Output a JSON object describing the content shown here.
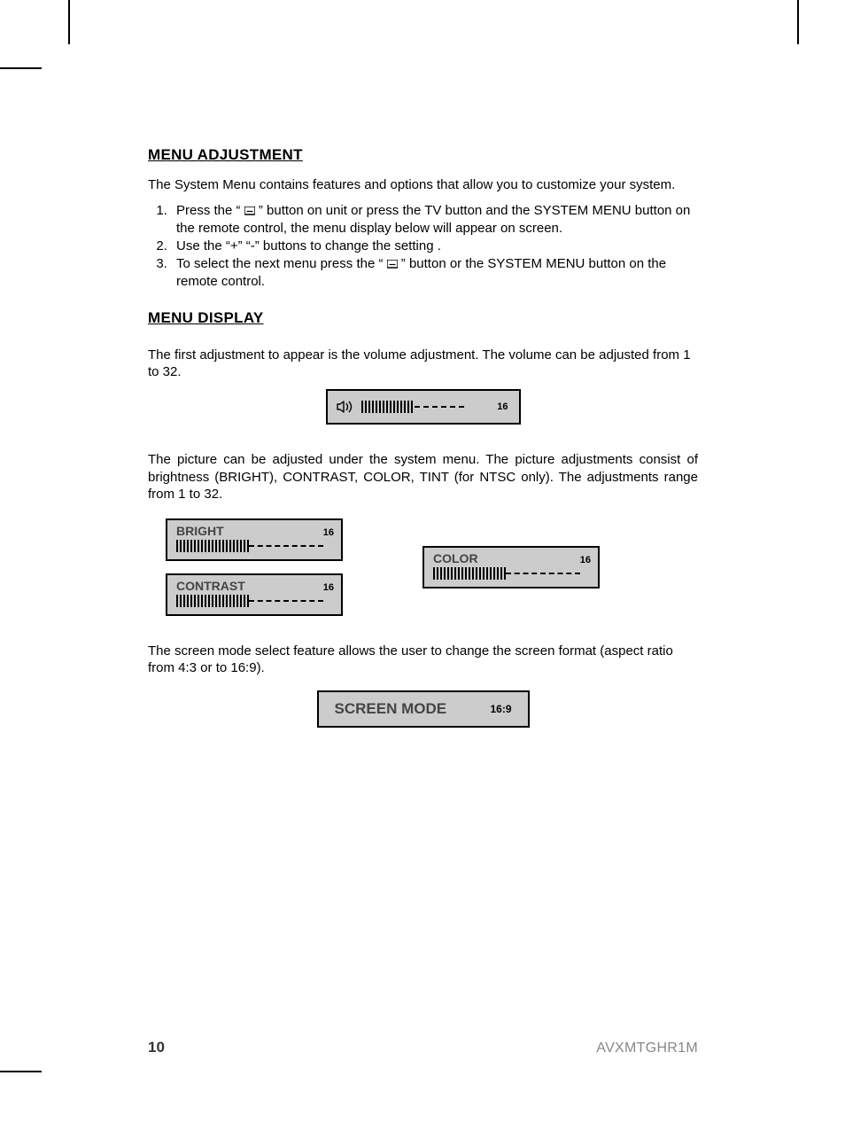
{
  "headings": {
    "menu_adjustment": "MENU ADJUSTMENT",
    "menu_display": "MENU DISPLAY"
  },
  "intro": "The System Menu contains features and options that allow you to customize your system.",
  "steps": {
    "s1a": "Press the “ ",
    "s1b": " ” button on unit or  press the TV button and the SYSTEM MENU button on the remote control, the menu display below will appear on screen.",
    "s2": "Use the “+”  “-” buttons  to change the setting .",
    "s3a": "To select the next menu press  the “ ",
    "s3b": " ” button or the SYSTEM MENU button on the remote control."
  },
  "volume_para": "The first adjustment to appear is the volume adjustment. The volume can be adjusted from 1 to 32.",
  "volume": {
    "value": "16"
  },
  "picture_para": "The picture can be adjusted under the system menu. The picture adjustments consist of brightness (BRIGHT), CONTRAST, COLOR, TINT (for NTSC only). The adjustments range from 1 to 32.",
  "picture": {
    "bright": {
      "label": "BRIGHT",
      "value": "16"
    },
    "contrast": {
      "label": "CONTRAST",
      "value": "16"
    },
    "color": {
      "label": "COLOR",
      "value": "16"
    }
  },
  "screen_para": "The screen mode select feature allows the user to change the screen format (aspect ratio from 4:3 or to 16:9).",
  "screen": {
    "label": "SCREEN MODE",
    "value": "16:9"
  },
  "footer": {
    "page": "10",
    "model": "AVXMTGHR1M"
  }
}
